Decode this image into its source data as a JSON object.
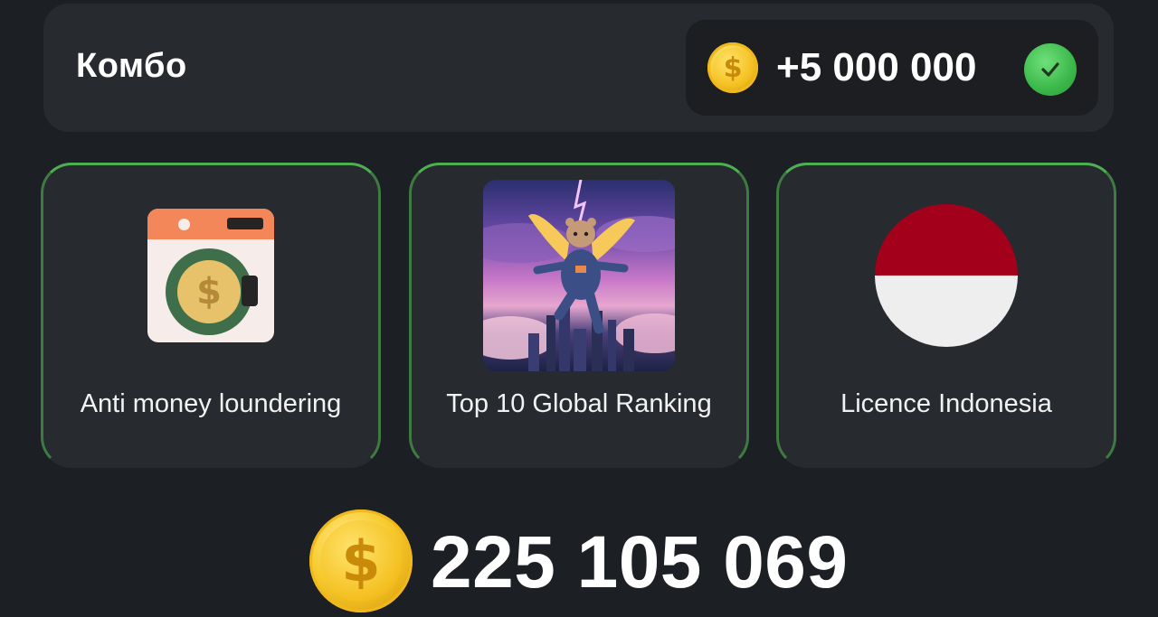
{
  "combo": {
    "title": "Комбо",
    "reward": "+5 000 000",
    "reward_icon": "coin-icon",
    "status_icon": "check-icon"
  },
  "cards": [
    {
      "label": "Anti money loundering",
      "icon": "washing-machine-coin-icon"
    },
    {
      "label": "Top 10 Global Ranking",
      "icon": "flying-hamster-image"
    },
    {
      "label": "Licence Indonesia",
      "icon": "indonesia-flag-icon"
    }
  ],
  "balance": {
    "value": "225 105 069",
    "icon": "coin-icon"
  },
  "colors": {
    "background": "#1c1f24",
    "card": "#272a2f",
    "accent_green": "#4caf50",
    "coin_gold": "#f7cb2e"
  }
}
